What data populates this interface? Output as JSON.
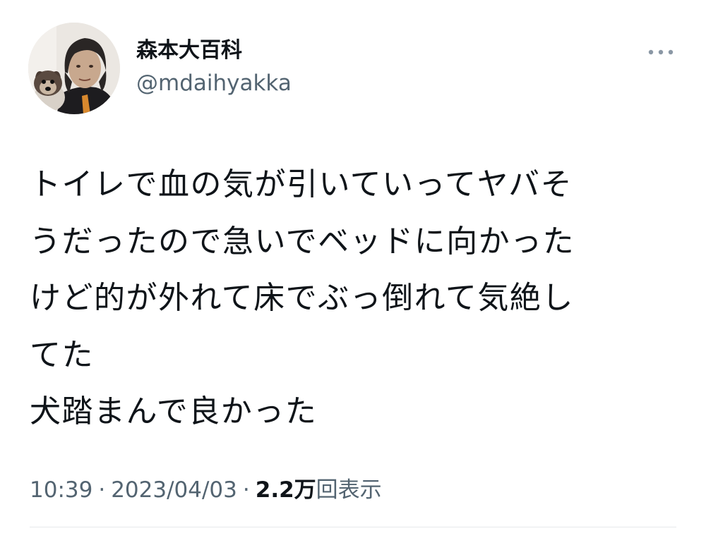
{
  "author": {
    "display_name": "森本大百科",
    "handle": "@mdaihyakka"
  },
  "tweet": {
    "lines": [
      "トイレで血の気が引いていってヤバそ",
      "うだったので急いでベッドに向かった",
      "けど的が外れて床でぶっ倒れて気絶し",
      "てた",
      "犬踏まんで良かった"
    ]
  },
  "meta": {
    "time": "10:39",
    "separator": "·",
    "date": "2023/04/03",
    "views_count": "2.2万",
    "views_label": "回表示"
  },
  "icons": {
    "more": "more-horizontal-icon",
    "avatar": "profile-photo"
  },
  "colors": {
    "text_primary": "#0f1419",
    "text_secondary": "#536471",
    "divider": "#e6e9eb"
  }
}
